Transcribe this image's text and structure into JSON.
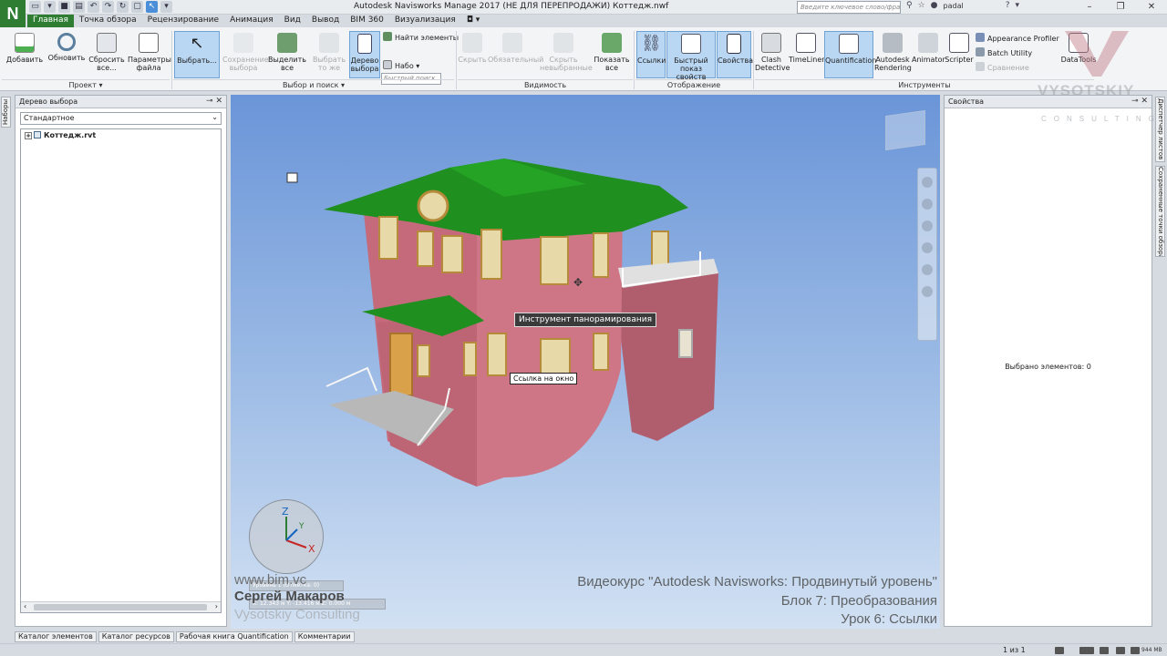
{
  "app": {
    "logo_letter": "N",
    "window_title": "Autodesk Navisworks Manage 2017 (НЕ ДЛЯ ПЕРЕПРОДАЖИ)    Коттедж.nwf",
    "search_placeholder": "Введите ключевое слово/фразу",
    "username": "padal"
  },
  "ribbon_tabs": [
    {
      "label": "Главная",
      "active": true
    },
    {
      "label": "Точка обзора"
    },
    {
      "label": "Рецензирование"
    },
    {
      "label": "Анимация"
    },
    {
      "label": "Вид"
    },
    {
      "label": "Вывод"
    },
    {
      "label": "BIM 360"
    },
    {
      "label": "Визуализация"
    }
  ],
  "ribbon": {
    "project": {
      "label": "Проект ▾",
      "add": "Добавить",
      "refresh": "Обновить",
      "reset_all": "Сбросить все...",
      "file_options": "Параметры файла"
    },
    "select_search": {
      "label": "Выбор и поиск ▾",
      "select": "Выбрать...",
      "save_selection": "Сохранение выбора",
      "select_all": "Выделить все",
      "select_same": "Выбрать то же",
      "selection_tree": "Дерево выбора",
      "find_items": "Найти элементы",
      "quick_find_placeholder": "Быстрый поиск",
      "sets": "Набо"
    },
    "visibility": {
      "label": "Видимость",
      "hide": "Скрыть",
      "require": "Обязательный",
      "hide_unselected": "Скрыть невыбранные",
      "unhide_all": "Показать все"
    },
    "display": {
      "label": "Отображение",
      "links": "Ссылки",
      "quick_properties": "Быстрый показ свойств",
      "properties": "Свойства"
    },
    "tools": {
      "label": "Инструменты",
      "clash_detective": "Clash Detective",
      "timeliner": "TimeLiner",
      "quantification": "Quantification",
      "autodesk_rendering": "Autodesk Rendering",
      "animator": "Animator",
      "scripter": "Scripter",
      "appearance_profiler": "Appearance Profiler",
      "batch_utility": "Batch Utility",
      "compare": "Сравнение",
      "datatools": "DataTools"
    }
  },
  "left_strip": {
    "tab": "Наборы"
  },
  "tree_panel": {
    "title": "Дерево выбора",
    "dropdown_value": "Стандартное",
    "root_item": "Коттедж.rvt"
  },
  "viewport": {
    "pan_tooltip": "Инструмент панорамирования",
    "link_tag": "Ссылка на окно",
    "axis_x": "X",
    "axis_y": "Y",
    "axis_z": "Z",
    "coord_line1": "Уровень 1 (Отметка: 0)",
    "coord_line2": "X: 12.343 м  Y: -13.416 м  Z: 0.000 м",
    "watermark_url": "www.bim.vc",
    "watermark_name": "Сергей Макаров",
    "watermark_company": "Vysotskiy Consulting",
    "course_title": "Видеокурс \"Autodesk Navisworks: Продвинутый уровень\"",
    "course_block": "Блок 7: Преобразования",
    "course_lesson": "Урок 6: Ссылки"
  },
  "props_panel": {
    "title": "Свойства",
    "selected_count": "Выбрано элементов: 0",
    "brand": "VYSOTSKIY",
    "brand_sub": "CONSULTING"
  },
  "right_strip": {
    "tab1": "Диспетчер листов",
    "tab2": "Сохраненные точки обзора"
  },
  "bottom_tabs": [
    "Каталог элементов",
    "Каталог ресурсов",
    "Рабочая книга Quantification",
    "Комментарии"
  ],
  "status": {
    "page_counter": "1 из 1",
    "memory": "944 MB"
  },
  "colors": {
    "accent_green": "#2e7d32",
    "wall_pink": "#c46a7a",
    "roof_green": "#1f8f1f",
    "viewport_top": "#6a95d8",
    "viewport_bottom": "#d2e1f3"
  }
}
